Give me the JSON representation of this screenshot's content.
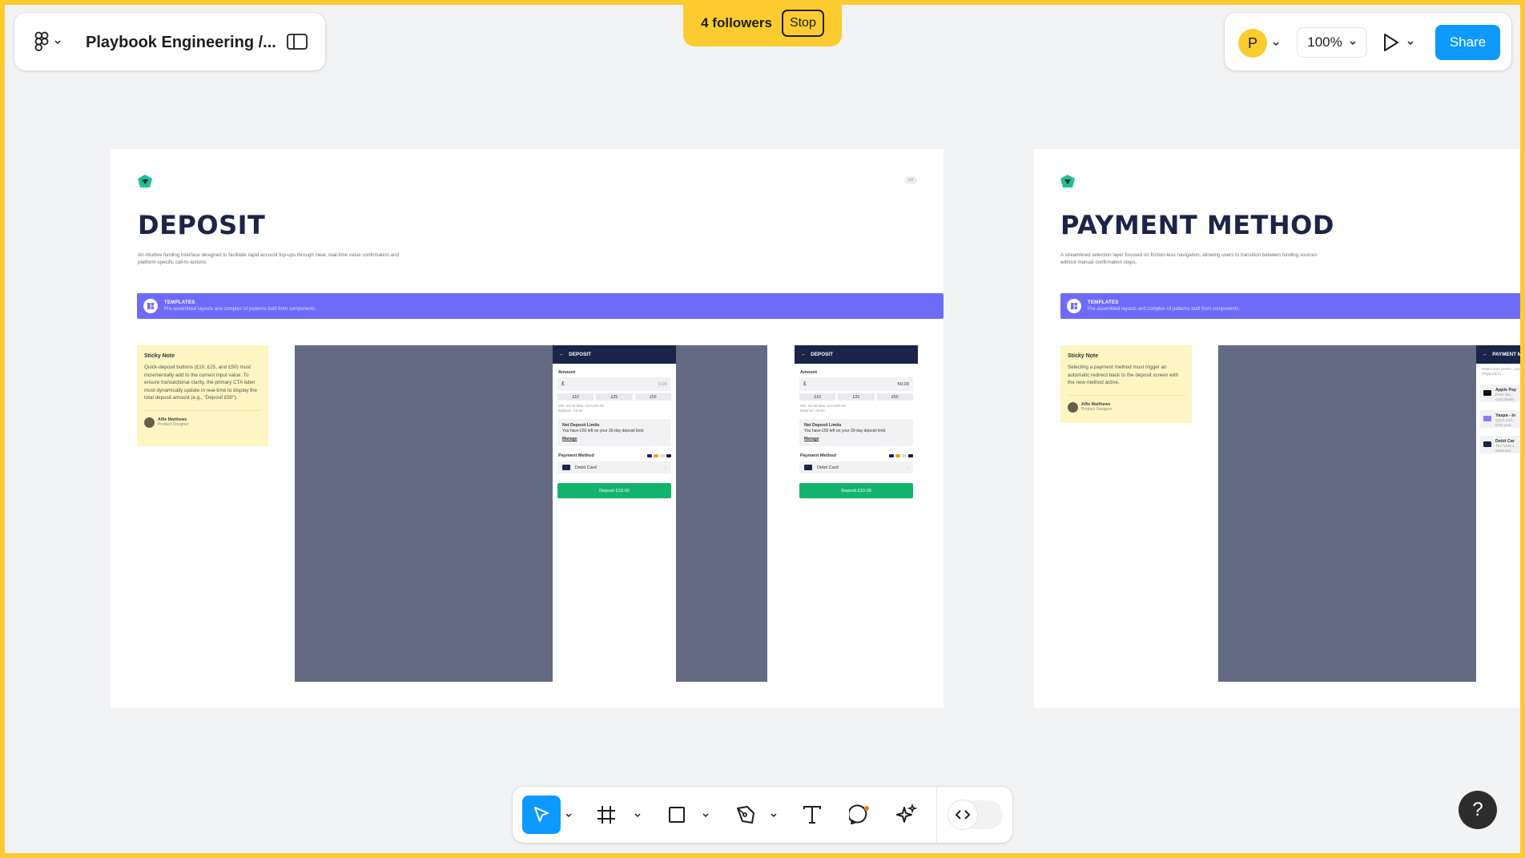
{
  "topbar": {
    "file_title": "Playbook Engineering /...",
    "followers_label": "4 followers",
    "stop_label": "Stop",
    "avatar_initial": "P",
    "zoom": "100%",
    "share_label": "Share"
  },
  "colors": {
    "follow_accent": "#fccb2f",
    "share_blue": "#0d99ff",
    "board_title": "#1b2549",
    "templates_band": "#6e6bfb",
    "sticky_bg": "#fdf6c3",
    "cta_green": "#12b36f"
  },
  "boards": {
    "deposit": {
      "title": "DEPOSIT",
      "description": "An intuitive funding interface designed to facilitate rapid account top-ups through clear, real-time value confirmation and platform-specific call-to-actions.",
      "corner_badge": "UX",
      "templates_title": "TEMPLATES",
      "templates_sub": "Pre-assembled layouts and complex UI patterns built from components.",
      "sticky": {
        "heading": "Sticky Note",
        "body": "Quick-deposit buttons (£10, £25, and £50) must incrementally add to the current input value. To ensure transactional clarity, the primary CTA label must dynamically update in real-time to display the total deposit amount (e.g., \"Deposit £50\").",
        "author": "Alfie Matthews",
        "role": "Product Designer"
      },
      "screens": [
        {
          "header": "DEPOSIT",
          "amount_label": "Amount",
          "currency": "£",
          "amount_value": "0.00",
          "quick": [
            "£10",
            "£25",
            "£50"
          ],
          "minmax": "Min: £5.00 Max: £10,000.00",
          "balance": "Balance: £0.50",
          "limits_title": "Net Deposit Limits",
          "limits_body": "You have £50 left on your 30-day deposit limit.",
          "manage": "Manage",
          "pm_label": "Payment Method",
          "card": "Debit Card",
          "cta": "Deposit £10.00"
        },
        {
          "header": "DEPOSIT",
          "amount_label": "Amount",
          "currency": "£",
          "amount_value": "50.00",
          "quick": [
            "£10",
            "£25",
            "£50"
          ],
          "minmax": "Min: £5.00 Max: £10,000.00",
          "balance": "Balance: £0.50",
          "limits_title": "Net Deposit Limits",
          "limits_body": "You have £50 left on your 30-day deposit limit.",
          "manage": "Manage",
          "pm_label": "Payment Method",
          "card": "Debit Card",
          "cta": "Deposit £10.00"
        }
      ]
    },
    "payment": {
      "title": "PAYMENT METHOD",
      "description": "A streamlined selection layer focused on friction-less navigation, allowing users to transition between funding sources without manual confirmation steps.",
      "templates_title": "TEMPLATES",
      "templates_sub": "Pre-assembled layouts and complex UI patterns built from components.",
      "sticky": {
        "heading": "Sticky Note",
        "body": "Selecting a payment method must trigger an automatic redirect back to the deposit screen with the new method active.",
        "author": "Alfie Matthews",
        "role": "Product Designer"
      },
      "screen": {
        "header": "PAYMENT M",
        "intro": "Select your prefer... your Playbook fu...",
        "options": [
          {
            "title": "Apple Pay",
            "sub": "Refer fas... card details"
          },
          {
            "title": "Yaspa - In",
            "sub": "Quick and... from your..."
          },
          {
            "title": "Debit Car",
            "sub": "The most u... deducted..."
          }
        ]
      }
    }
  },
  "toolbar": {
    "tools": [
      "move-tool",
      "frame-tool",
      "shape-tool",
      "pen-tool",
      "text-tool",
      "comment-tool",
      "actions-tool",
      "dev-mode-toggle"
    ]
  },
  "help_label": "?"
}
